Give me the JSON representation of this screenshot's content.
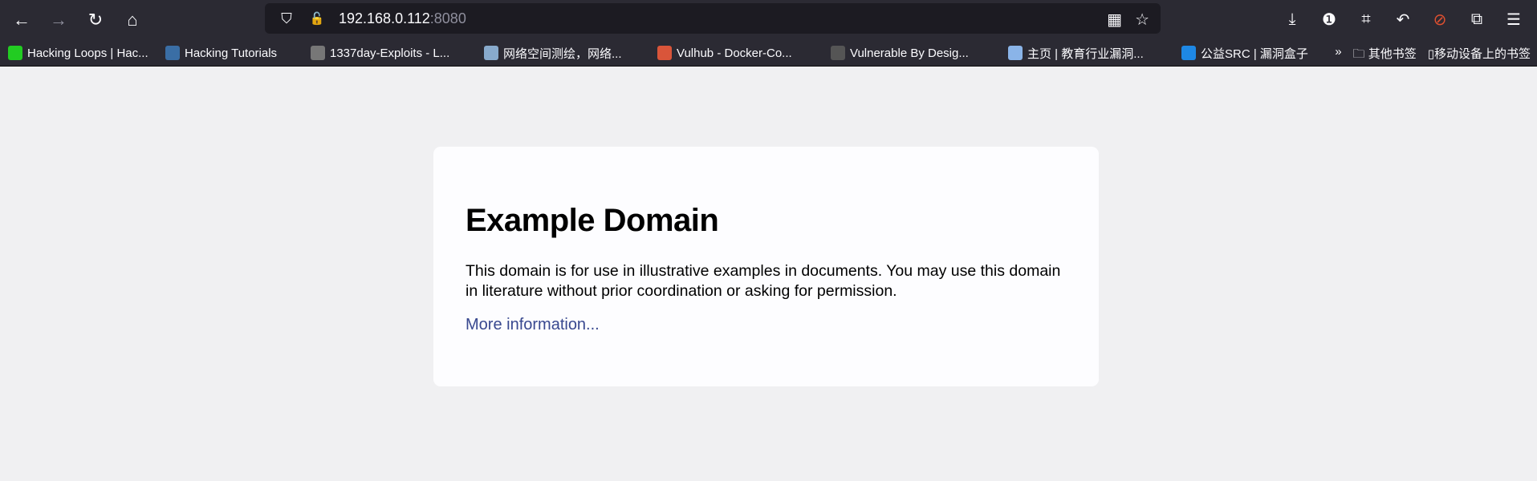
{
  "browser": {
    "url_host": "192.168.0.112",
    "url_port": ":8080",
    "nav": [
      {
        "name": "back-icon",
        "glyph": "←"
      },
      {
        "name": "forward-icon",
        "glyph": "→"
      },
      {
        "name": "reload-icon",
        "glyph": "↻"
      },
      {
        "name": "home-icon",
        "glyph": "⌂"
      }
    ],
    "url_icons": {
      "shield": "⛉",
      "lock": "🔓",
      "qr": "▦",
      "star": "☆"
    },
    "tools": [
      {
        "name": "download-icon",
        "glyph": "⤓"
      },
      {
        "name": "password-manager-icon",
        "glyph": "❶"
      },
      {
        "name": "crop-icon",
        "glyph": "⌗"
      },
      {
        "name": "undo-icon",
        "glyph": "↶"
      },
      {
        "name": "extension-addon-icon",
        "glyph": "⊘"
      },
      {
        "name": "extensions-icon",
        "glyph": "⧉"
      },
      {
        "name": "menu-icon",
        "glyph": "☰"
      }
    ],
    "bookmarks": [
      {
        "label": "Hacking Loops | Hac...",
        "color": "#22cc22"
      },
      {
        "label": "Hacking Tutorials",
        "color": "#3a6ea5"
      },
      {
        "label": "1337day-Exploits - L...",
        "color": "#777777"
      },
      {
        "label": "网络空间测绘，网络...",
        "color": "#88aacc"
      },
      {
        "label": "Vulhub - Docker-Co...",
        "color": "#d9553a"
      },
      {
        "label": "Vulnerable By Desig...",
        "color": "#555555"
      },
      {
        "label": "主页 | 教育行业漏洞...",
        "color": "#8ab4e8"
      },
      {
        "label": "公益SRC | 漏洞盒子",
        "color": "#1e88e5"
      }
    ],
    "overflow": "»",
    "other_bookmarks": "其他书签",
    "mobile_bookmarks": "移动设备上的书签"
  },
  "page": {
    "title": "Example Domain",
    "body": "This domain is for use in illustrative examples in documents. You may use this domain in literature without prior coordination or asking for permission.",
    "link": "More information..."
  }
}
